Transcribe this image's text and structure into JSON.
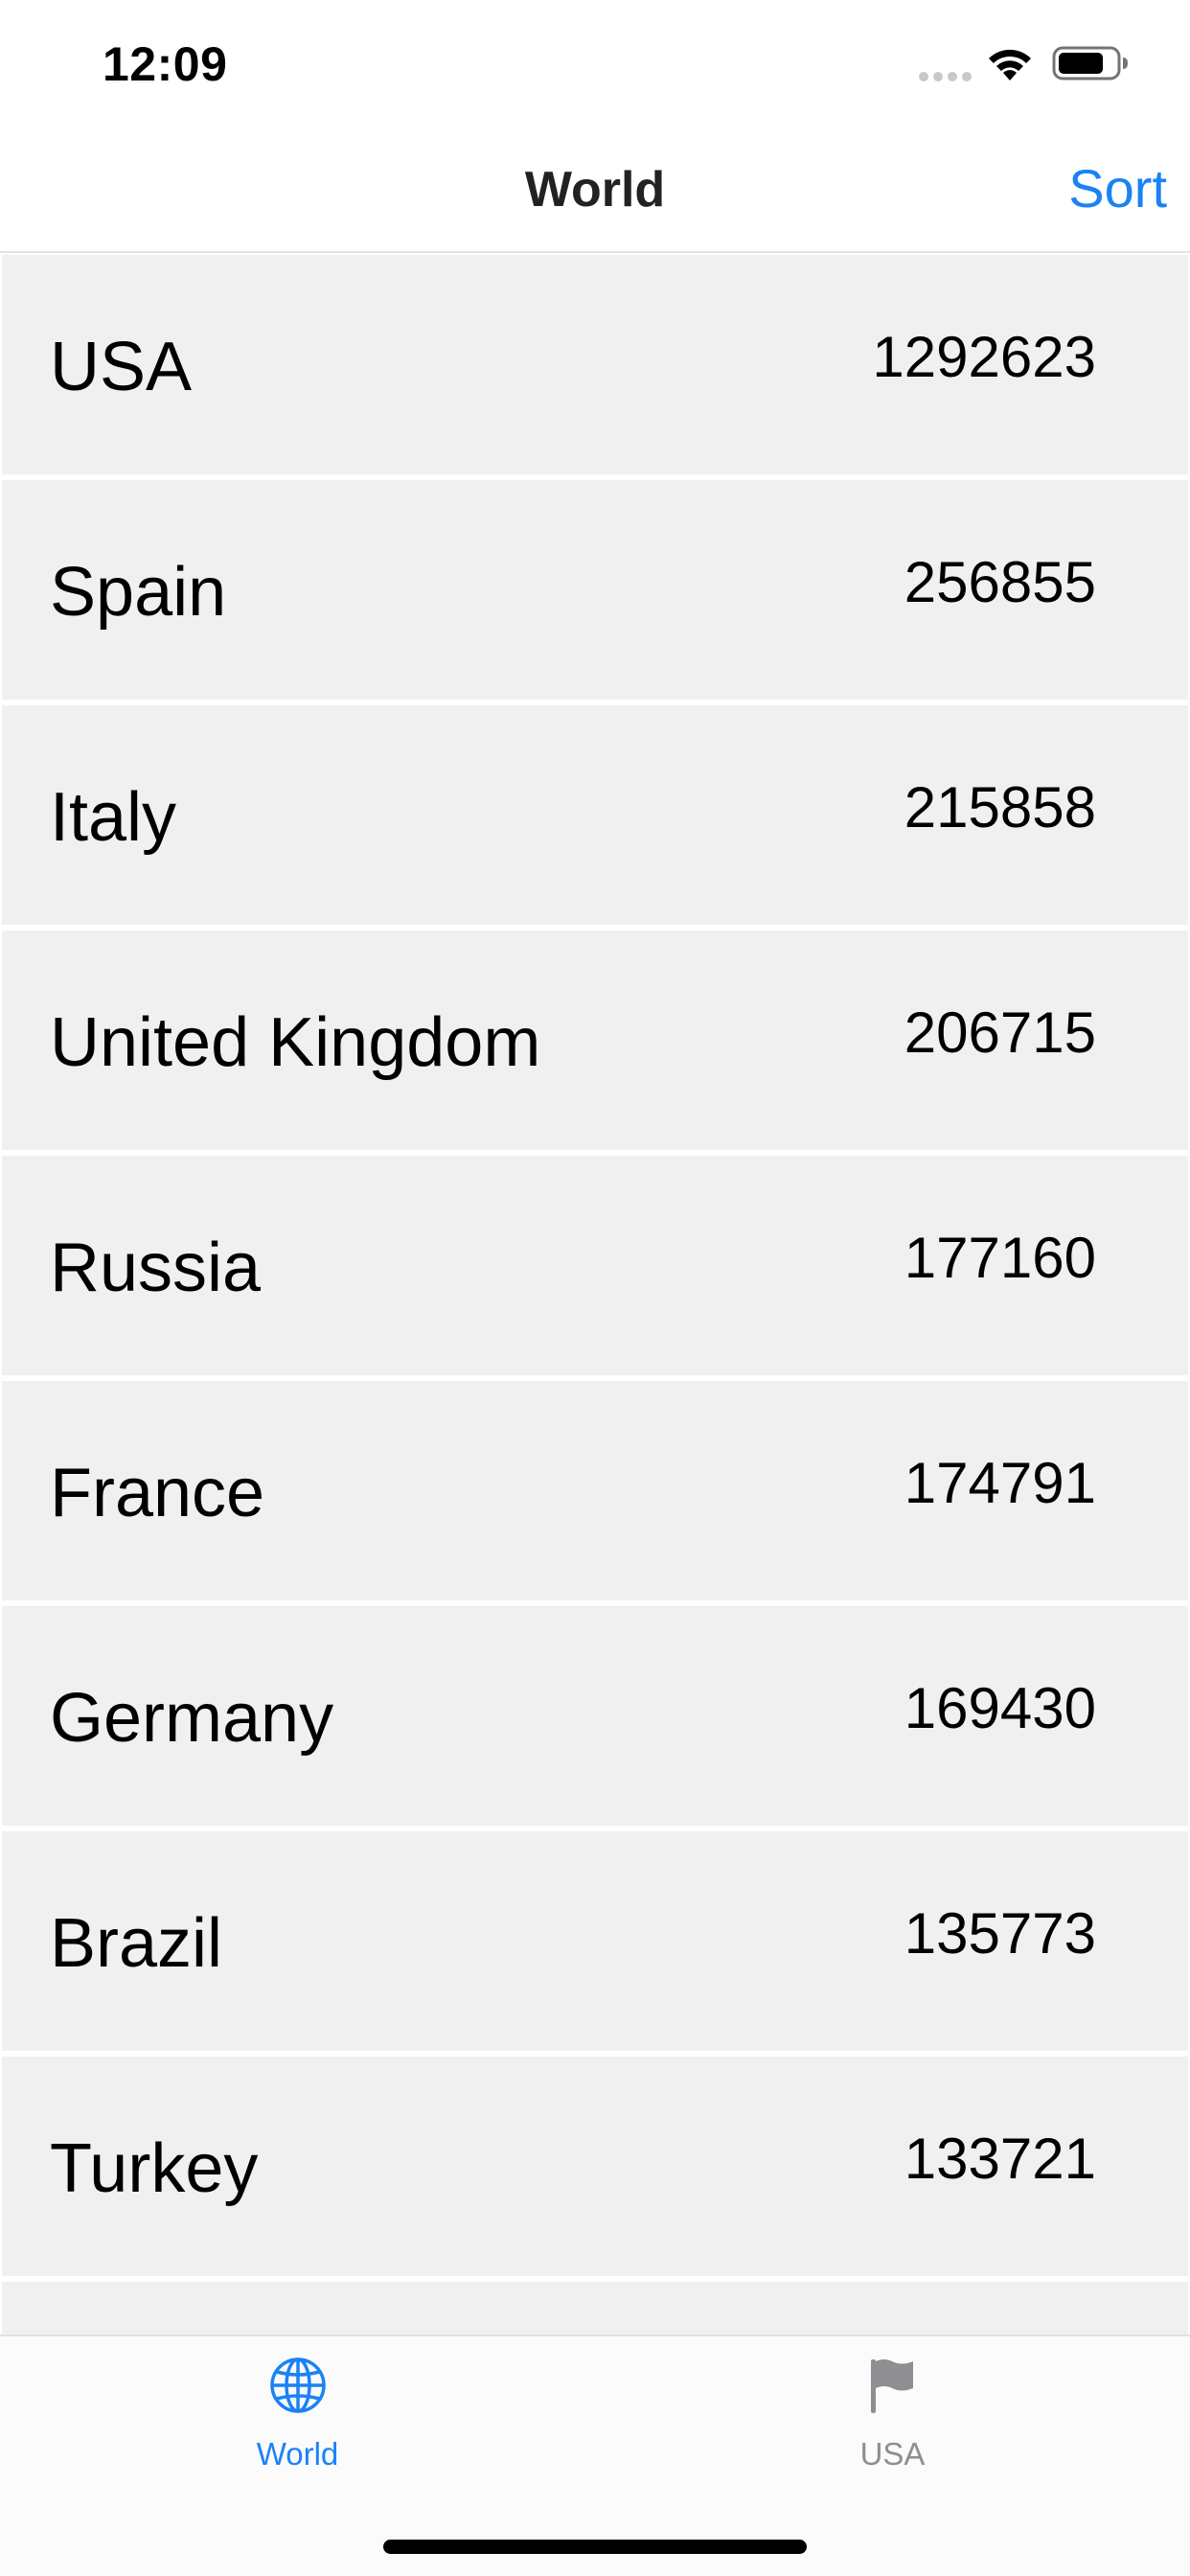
{
  "status_bar": {
    "time": "12:09",
    "signal_icon": "signal-dots-icon",
    "wifi_icon": "wifi-icon",
    "battery_icon": "battery-icon"
  },
  "nav": {
    "title": "World",
    "sort_label": "Sort"
  },
  "rows": [
    {
      "name": "USA",
      "value": "1292623"
    },
    {
      "name": "Spain",
      "value": "256855"
    },
    {
      "name": "Italy",
      "value": "215858"
    },
    {
      "name": "United Kingdom",
      "value": "206715"
    },
    {
      "name": "Russia",
      "value": "177160"
    },
    {
      "name": "France",
      "value": "174791"
    },
    {
      "name": "Germany",
      "value": "169430"
    },
    {
      "name": "Brazil",
      "value": "135773"
    },
    {
      "name": "Turkey",
      "value": "133721"
    },
    {
      "name": "",
      "value": ""
    }
  ],
  "tabs": [
    {
      "label": "World",
      "icon": "globe-icon",
      "selected": true
    },
    {
      "label": "USA",
      "icon": "flag-icon",
      "selected": false
    }
  ],
  "colors": {
    "accent": "#1a82f5",
    "tab_inactive": "#8e8e93",
    "row_background": "#f0f0f0"
  }
}
